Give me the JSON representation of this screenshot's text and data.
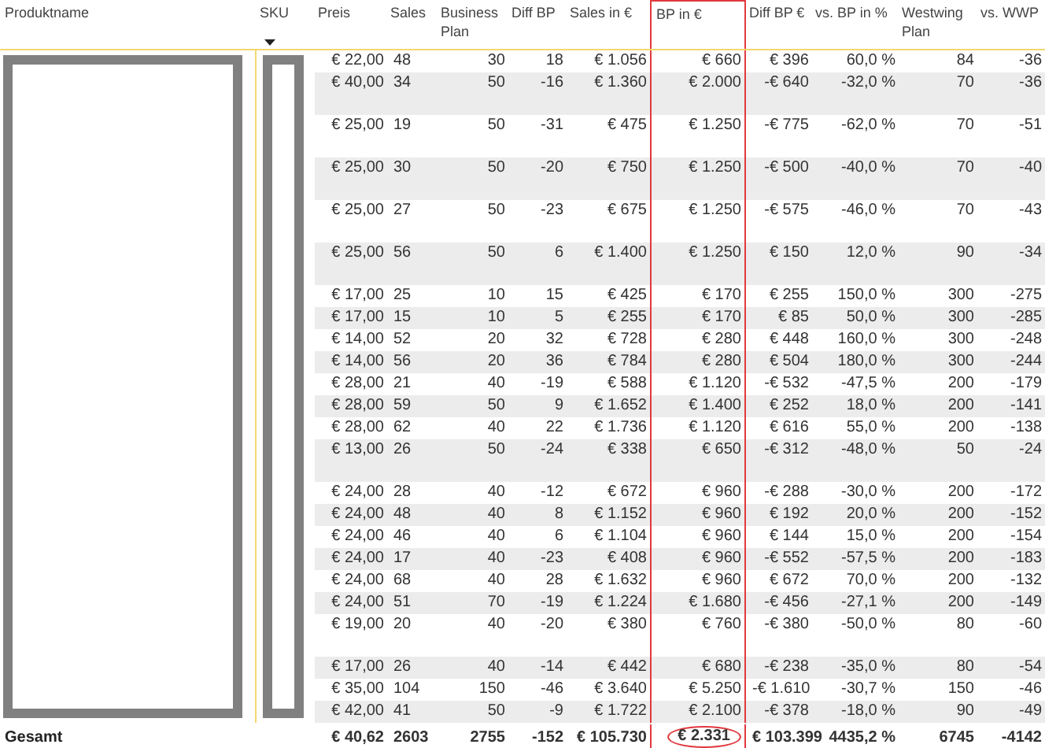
{
  "table": {
    "key_columns": [
      {
        "label": "Produktname",
        "sorted": false
      },
      {
        "label": "SKU",
        "sorted": true
      }
    ],
    "columns": [
      {
        "label": "Preis",
        "sorted": false,
        "highlighted": false
      },
      {
        "label": "Sales",
        "sorted": false,
        "highlighted": false
      },
      {
        "label": "Business Plan",
        "sorted": false,
        "highlighted": false
      },
      {
        "label": "Diff BP",
        "sorted": false,
        "highlighted": false
      },
      {
        "label": "Sales in €",
        "sorted": false,
        "highlighted": false
      },
      {
        "label": "BP in €",
        "sorted": false,
        "highlighted": true
      },
      {
        "label": "Diff BP €",
        "sorted": false,
        "highlighted": false
      },
      {
        "label": "vs. BP in %",
        "sorted": false,
        "highlighted": false
      },
      {
        "label": "Westwing Plan",
        "sorted": false,
        "highlighted": false
      },
      {
        "label": "vs. WWP",
        "sorted": false,
        "highlighted": false
      }
    ],
    "rows": [
      {
        "cells": [
          "€ 22,00",
          "48",
          "30",
          "18",
          "€ 1.056",
          "€ 660",
          "€ 396",
          "60,0 %",
          "84",
          "-36"
        ]
      },
      {
        "cells": [
          "€ 40,00",
          "34",
          "50",
          "-16",
          "€ 1.360",
          "€ 2.000",
          "-€ 640",
          "-32,0 %",
          "70",
          "-36"
        ]
      },
      {
        "cells": [
          "€ 25,00",
          "19",
          "50",
          "-31",
          "€ 475",
          "€ 1.250",
          "-€ 775",
          "-62,0 %",
          "70",
          "-51"
        ]
      },
      {
        "cells": [
          "€ 25,00",
          "30",
          "50",
          "-20",
          "€ 750",
          "€ 1.250",
          "-€ 500",
          "-40,0 %",
          "70",
          "-40"
        ]
      },
      {
        "cells": [
          "€ 25,00",
          "27",
          "50",
          "-23",
          "€ 675",
          "€ 1.250",
          "-€ 575",
          "-46,0 %",
          "70",
          "-43"
        ]
      },
      {
        "cells": [
          "€ 25,00",
          "56",
          "50",
          "6",
          "€ 1.400",
          "€ 1.250",
          "€ 150",
          "12,0 %",
          "90",
          "-34"
        ]
      },
      {
        "cells": [
          "€ 17,00",
          "25",
          "10",
          "15",
          "€ 425",
          "€ 170",
          "€ 255",
          "150,0 %",
          "300",
          "-275"
        ]
      },
      {
        "cells": [
          "€ 17,00",
          "15",
          "10",
          "5",
          "€ 255",
          "€ 170",
          "€ 85",
          "50,0 %",
          "300",
          "-285"
        ]
      },
      {
        "cells": [
          "€ 14,00",
          "52",
          "20",
          "32",
          "€ 728",
          "€ 280",
          "€ 448",
          "160,0 %",
          "300",
          "-248"
        ]
      },
      {
        "cells": [
          "€ 14,00",
          "56",
          "20",
          "36",
          "€ 784",
          "€ 280",
          "€ 504",
          "180,0 %",
          "300",
          "-244"
        ]
      },
      {
        "cells": [
          "€ 28,00",
          "21",
          "40",
          "-19",
          "€ 588",
          "€ 1.120",
          "-€ 532",
          "-47,5 %",
          "200",
          "-179"
        ]
      },
      {
        "cells": [
          "€ 28,00",
          "59",
          "50",
          "9",
          "€ 1.652",
          "€ 1.400",
          "€ 252",
          "18,0 %",
          "200",
          "-141"
        ]
      },
      {
        "cells": [
          "€ 28,00",
          "62",
          "40",
          "22",
          "€ 1.736",
          "€ 1.120",
          "€ 616",
          "55,0 %",
          "200",
          "-138"
        ]
      },
      {
        "cells": [
          "€ 13,00",
          "26",
          "50",
          "-24",
          "€ 338",
          "€ 650",
          "-€ 312",
          "-48,0 %",
          "50",
          "-24"
        ]
      },
      {
        "cells": [
          "€ 24,00",
          "28",
          "40",
          "-12",
          "€ 672",
          "€ 960",
          "-€ 288",
          "-30,0 %",
          "200",
          "-172"
        ]
      },
      {
        "cells": [
          "€ 24,00",
          "48",
          "40",
          "8",
          "€ 1.152",
          "€ 960",
          "€ 192",
          "20,0 %",
          "200",
          "-152"
        ]
      },
      {
        "cells": [
          "€ 24,00",
          "46",
          "40",
          "6",
          "€ 1.104",
          "€ 960",
          "€ 144",
          "15,0 %",
          "200",
          "-154"
        ]
      },
      {
        "cells": [
          "€ 24,00",
          "17",
          "40",
          "-23",
          "€ 408",
          "€ 960",
          "-€ 552",
          "-57,5 %",
          "200",
          "-183"
        ]
      },
      {
        "cells": [
          "€ 24,00",
          "68",
          "40",
          "28",
          "€ 1.632",
          "€ 960",
          "€ 672",
          "70,0 %",
          "200",
          "-132"
        ]
      },
      {
        "cells": [
          "€ 24,00",
          "51",
          "70",
          "-19",
          "€ 1.224",
          "€ 1.680",
          "-€ 456",
          "-27,1 %",
          "200",
          "-149"
        ]
      },
      {
        "cells": [
          "€ 19,00",
          "20",
          "40",
          "-20",
          "€ 380",
          "€ 760",
          "-€ 380",
          "-50,0 %",
          "80",
          "-60"
        ]
      },
      {
        "cells": [
          "€ 17,00",
          "26",
          "40",
          "-14",
          "€ 442",
          "€ 680",
          "-€ 238",
          "-35,0 %",
          "80",
          "-54"
        ]
      },
      {
        "cells": [
          "€ 35,00",
          "104",
          "150",
          "-46",
          "€ 3.640",
          "€ 5.250",
          "-€ 1.610",
          "-30,7 %",
          "150",
          "-46"
        ]
      },
      {
        "cells": [
          "€ 42,00",
          "41",
          "50",
          "-9",
          "€ 1.722",
          "€ 2.100",
          "-€ 378",
          "-18,0 %",
          "90",
          "-49"
        ]
      }
    ],
    "total": {
      "label": "Gesamt",
      "cells": [
        "€ 40,62",
        "2603",
        "2755",
        "-152",
        "€ 105.730",
        "€ 2.331",
        "€ 103.399",
        "4435,2 %",
        "6745",
        "-4142"
      ]
    }
  }
}
